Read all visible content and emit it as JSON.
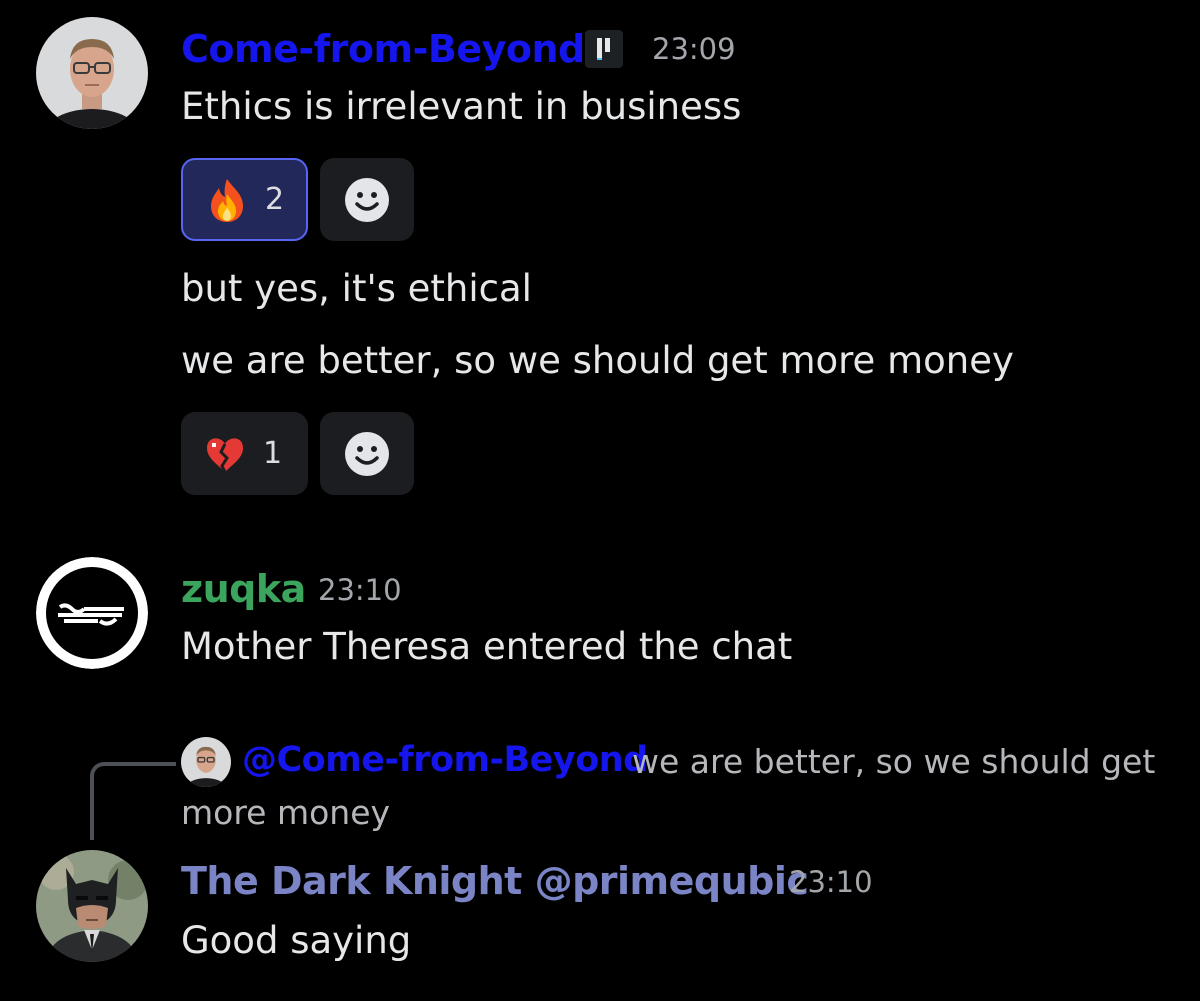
{
  "messages": [
    {
      "username": "Come-from-Beyond",
      "username_color": "#1515ee",
      "timestamp": "23:09",
      "lines": [
        "Ethics is irrelevant in business",
        "but yes, it's ethical",
        "we are better, so we should get more money"
      ],
      "reactions": [
        {
          "emoji": "fire-emoji",
          "count": "2",
          "active": true
        },
        {
          "emoji": "broken-heart-emoji",
          "count": "1",
          "active": false
        }
      ]
    },
    {
      "username": "zuqka",
      "username_color": "#3ba55d",
      "timestamp": "23:10",
      "lines": [
        "Mother Theresa entered the chat"
      ]
    },
    {
      "reply": {
        "mention": "@Come-from-Beyond",
        "text_line1": "we are better, so we should get",
        "text_line2": "more money"
      },
      "username": "The Dark Knight @primequbic",
      "username_color": "#7b84c4",
      "timestamp": "23:10",
      "lines": [
        "Good saying"
      ]
    }
  ],
  "icons": {
    "add_reaction": "smiley-add-reaction-icon",
    "tag_badge": "server-tag-icon"
  }
}
